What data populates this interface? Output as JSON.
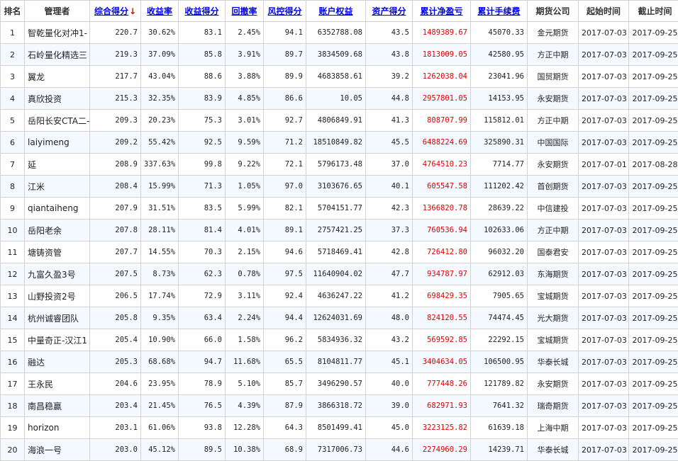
{
  "headers": [
    {
      "label": "排名",
      "sortable": false
    },
    {
      "label": "管理者",
      "sortable": false
    },
    {
      "label": "综合得分",
      "sortable": true,
      "arrow": "↓"
    },
    {
      "label": "收益率",
      "sortable": true
    },
    {
      "label": "收益得分",
      "sortable": true
    },
    {
      "label": "回撤率",
      "sortable": true
    },
    {
      "label": "风控得分",
      "sortable": true
    },
    {
      "label": "账户权益",
      "sortable": true
    },
    {
      "label": "资产得分",
      "sortable": true
    },
    {
      "label": "累计净盈亏",
      "sortable": true
    },
    {
      "label": "累计手续费",
      "sortable": true
    },
    {
      "label": "期货公司",
      "sortable": false
    },
    {
      "label": "起始时间",
      "sortable": false
    },
    {
      "label": "截止时间",
      "sortable": false
    }
  ],
  "rows": [
    [
      "1",
      "智乾量化对冲1-",
      "220.7",
      "30.62%",
      "83.1",
      "2.45%",
      "94.1",
      "6352788.08",
      "43.5",
      "1489389.67",
      "45070.33",
      "金元期货",
      "2017-07-03",
      "2017-09-25"
    ],
    [
      "2",
      "石岭量化精选三",
      "219.3",
      "37.09%",
      "85.8",
      "3.91%",
      "89.7",
      "3834509.68",
      "43.8",
      "1813009.05",
      "42580.95",
      "方正中期",
      "2017-07-03",
      "2017-09-25"
    ],
    [
      "3",
      "翼龙",
      "217.7",
      "43.04%",
      "88.6",
      "3.88%",
      "89.9",
      "4683858.61",
      "39.2",
      "1262038.04",
      "23041.96",
      "国贸期货",
      "2017-07-03",
      "2017-09-25"
    ],
    [
      "4",
      "真欣投资",
      "215.3",
      "32.35%",
      "83.9",
      "4.85%",
      "86.6",
      "10.05",
      "44.8",
      "2957801.05",
      "14153.95",
      "永安期货",
      "2017-07-03",
      "2017-09-25"
    ],
    [
      "5",
      "岳阳长安CTA二-",
      "209.3",
      "20.23%",
      "75.3",
      "3.01%",
      "92.7",
      "4806849.91",
      "41.3",
      "808707.99",
      "115812.01",
      "方正中期",
      "2017-07-03",
      "2017-09-25"
    ],
    [
      "6",
      "laiyimeng",
      "209.2",
      "55.42%",
      "92.5",
      "9.59%",
      "71.2",
      "18510849.82",
      "45.5",
      "6488224.69",
      "325890.31",
      "中国国际",
      "2017-07-03",
      "2017-09-25"
    ],
    [
      "7",
      "延",
      "208.9",
      "337.63%",
      "99.8",
      "9.22%",
      "72.1",
      "5796173.48",
      "37.0",
      "4764510.23",
      "7714.77",
      "永安期货",
      "2017-07-01",
      "2017-08-28"
    ],
    [
      "8",
      "江米",
      "208.4",
      "15.99%",
      "71.3",
      "1.05%",
      "97.0",
      "3103676.65",
      "40.1",
      "605547.58",
      "111202.42",
      "首创期货",
      "2017-07-03",
      "2017-09-25"
    ],
    [
      "9",
      "qiantaiheng",
      "207.9",
      "31.51%",
      "83.5",
      "5.99%",
      "82.1",
      "5704151.77",
      "42.3",
      "1366820.78",
      "28639.22",
      "中信建投",
      "2017-07-03",
      "2017-09-25"
    ],
    [
      "10",
      "岳阳老余",
      "207.8",
      "28.11%",
      "81.4",
      "4.01%",
      "89.1",
      "2757421.25",
      "37.3",
      "760536.94",
      "102633.06",
      "方正中期",
      "2017-07-03",
      "2017-09-25"
    ],
    [
      "11",
      "塘铸资管",
      "207.7",
      "14.55%",
      "70.3",
      "2.15%",
      "94.6",
      "5718469.41",
      "42.8",
      "726412.80",
      "96032.20",
      "国泰君安",
      "2017-07-03",
      "2017-09-25"
    ],
    [
      "12",
      "九富久盈3号",
      "207.5",
      "8.73%",
      "62.3",
      "0.78%",
      "97.5",
      "11640904.02",
      "47.7",
      "934787.97",
      "62912.03",
      "东海期货",
      "2017-07-03",
      "2017-09-25"
    ],
    [
      "13",
      "山野投资2号",
      "206.5",
      "17.74%",
      "72.9",
      "3.11%",
      "92.4",
      "4636247.22",
      "41.2",
      "698429.35",
      "7905.65",
      "宝城期货",
      "2017-07-03",
      "2017-09-25"
    ],
    [
      "14",
      "杭州诚睿团队",
      "205.8",
      "9.35%",
      "63.4",
      "2.24%",
      "94.4",
      "12624031.69",
      "48.0",
      "824120.55",
      "74474.45",
      "光大期货",
      "2017-07-03",
      "2017-09-25"
    ],
    [
      "15",
      "中量奇正-汉江1",
      "205.4",
      "10.90%",
      "66.0",
      "1.58%",
      "96.2",
      "5834936.32",
      "43.2",
      "569592.85",
      "22292.15",
      "宝城期货",
      "2017-07-03",
      "2017-09-25"
    ],
    [
      "16",
      "融达",
      "205.3",
      "68.68%",
      "94.7",
      "11.68%",
      "65.5",
      "8104811.77",
      "45.1",
      "3404634.05",
      "106500.95",
      "华泰长城",
      "2017-07-03",
      "2017-09-25"
    ],
    [
      "17",
      "王永民",
      "204.6",
      "23.95%",
      "78.9",
      "5.10%",
      "85.7",
      "3496290.57",
      "40.0",
      "777448.26",
      "121789.82",
      "永安期货",
      "2017-07-03",
      "2017-09-25"
    ],
    [
      "18",
      "南昌稳赢",
      "203.4",
      "21.45%",
      "76.5",
      "4.39%",
      "87.9",
      "3866318.72",
      "39.0",
      "682971.93",
      "7641.32",
      "瑞奇期货",
      "2017-07-03",
      "2017-09-25"
    ],
    [
      "19",
      "horizon",
      "203.1",
      "61.06%",
      "93.8",
      "12.28%",
      "64.3",
      "8501499.41",
      "45.0",
      "3223125.82",
      "61639.18",
      "上海中期",
      "2017-07-03",
      "2017-09-25"
    ],
    [
      "20",
      "海浪一号",
      "203.0",
      "45.12%",
      "89.5",
      "10.38%",
      "68.9",
      "7317006.73",
      "44.6",
      "2274960.29",
      "14239.71",
      "华泰长城",
      "2017-07-03",
      "2017-09-25"
    ]
  ]
}
